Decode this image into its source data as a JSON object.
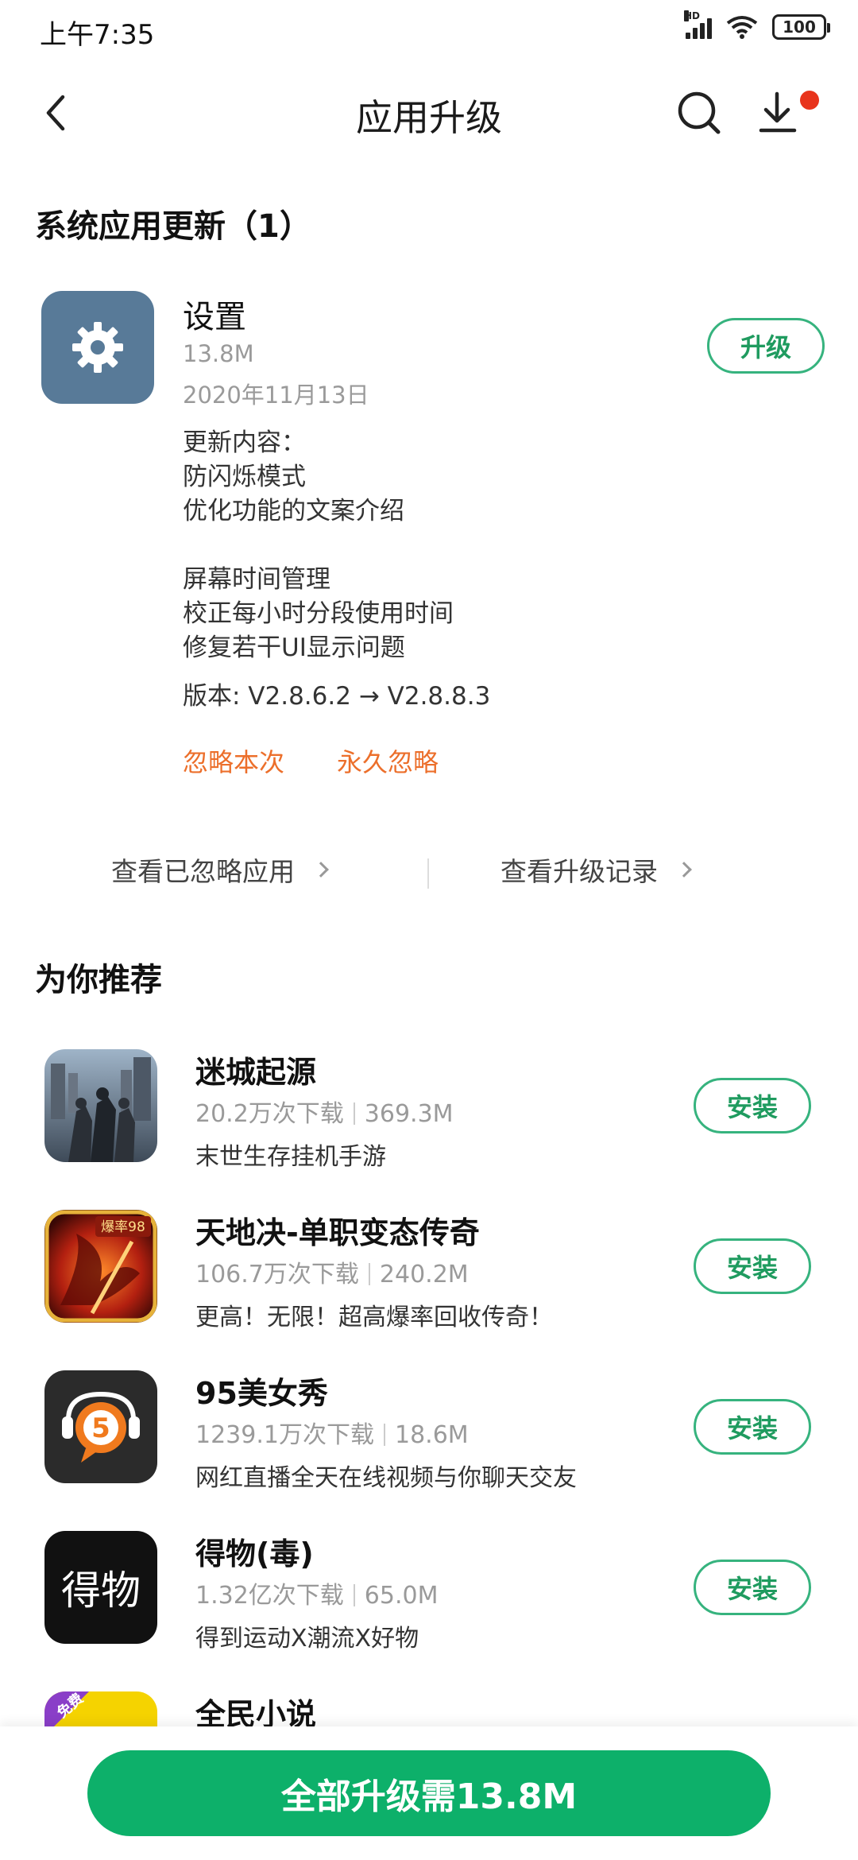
{
  "status_bar": {
    "time": "上午7:35",
    "hd": "HD",
    "battery": "100"
  },
  "header": {
    "title": "应用升级"
  },
  "system_updates": {
    "title": "系统应用更新（1）",
    "app": {
      "name": "设置",
      "size": "13.8M",
      "date": "2020年11月13日",
      "changelog": [
        "更新内容：",
        "防闪烁模式",
        "优化功能的文案介绍",
        "",
        "屏幕时间管理",
        "校正每小时分段使用时间",
        "修复若干UI显示问题"
      ],
      "version": "版本: V2.8.6.2 → V2.8.8.3",
      "button": "升级",
      "ignore_once": "忽略本次",
      "ignore_forever": "永久忽略"
    }
  },
  "links": {
    "ignored_apps": "查看已忽略应用",
    "upgrade_history": "查看升级记录"
  },
  "recommended": {
    "title": "为你推荐",
    "items": [
      {
        "name": "迷城起源",
        "downloads": "20.2万次下载",
        "size": "369.3M",
        "desc": "末世生存挂机手游",
        "button": "安装",
        "icon": "game-soldiers-icon",
        "icon_color": "#5b6f85"
      },
      {
        "name": "天地决-单职变态传奇",
        "downloads": "106.7万次下载",
        "size": "240.2M",
        "desc": "更高！无限！超高爆率回收传奇！",
        "button": "安装",
        "icon": "dragon-game-icon",
        "icon_color": "#b32010",
        "badge": "爆率98"
      },
      {
        "name": "95美女秀",
        "downloads": "1239.1万次下载",
        "size": "18.6M",
        "desc": "网红直播全天在线视频与你聊天交友",
        "button": "安装",
        "icon": "chat-five-icon",
        "icon_color": "#2b2b2b",
        "badge": "5"
      },
      {
        "name": "得物(毒)",
        "downloads": "1.32亿次下载",
        "size": "65.0M",
        "desc": "得到运动X潮流X好物",
        "button": "安装",
        "icon": "dewu-logo-icon",
        "icon_color": "#111111",
        "badge": "得物"
      },
      {
        "name": "全民小说",
        "downloads": "",
        "size": "",
        "desc": "",
        "button": "",
        "icon": "novel-app-icon",
        "icon_color": "#f5d300",
        "badge": "免费"
      }
    ]
  },
  "bottom": {
    "upgrade_all": "全部升级需13.8M"
  },
  "colors": {
    "accent_green": "#0db06a",
    "ignore_orange": "#ec6f2b",
    "notification_red": "#e8341c"
  }
}
